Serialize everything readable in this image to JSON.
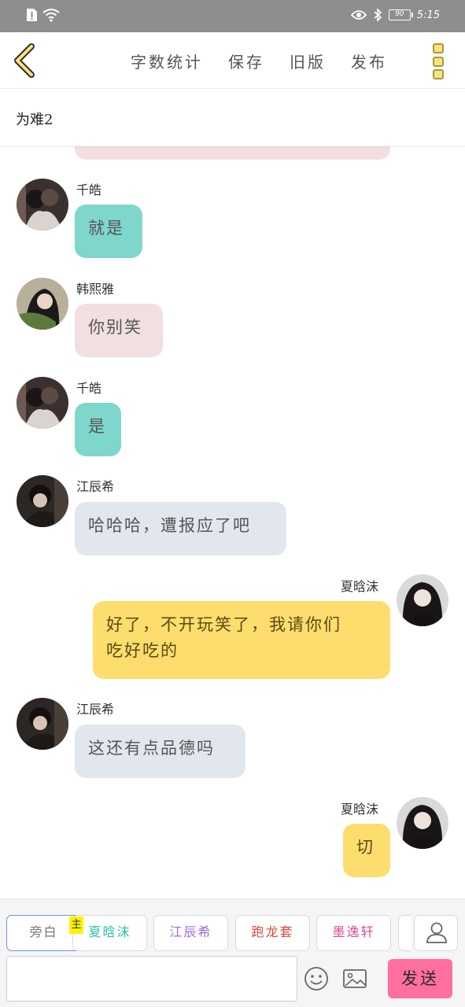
{
  "status": {
    "time": "5:15",
    "battery": "90"
  },
  "nav": {
    "actions": [
      "字数统计",
      "保存",
      "旧版",
      "发布"
    ]
  },
  "title": "为难2",
  "messages": [
    {
      "sender": "千皓",
      "text": "就是"
    },
    {
      "sender": "韩熙雅",
      "text": "你别笑"
    },
    {
      "sender": "千皓",
      "text": "是"
    },
    {
      "sender": "江辰希",
      "text": "哈哈哈，遭报应了吧"
    },
    {
      "sender": "夏晗沫",
      "text_line1": "好了，不开玩笑了，我请你们",
      "text_line2": "吃好吃的"
    },
    {
      "sender": "江辰希",
      "text": "这还有点品德吗"
    },
    {
      "sender": "夏晗沫",
      "text": "切"
    }
  ],
  "composer": {
    "main_tag": "主",
    "roles": [
      {
        "label": "旁白",
        "color": "#555555"
      },
      {
        "label": "夏晗沫",
        "color": "#2bbfae"
      },
      {
        "label": "江辰希",
        "color": "#a66bd6"
      },
      {
        "label": "跑龙套",
        "color": "#e0473a"
      },
      {
        "label": "墨逸轩",
        "color": "#e0479a"
      }
    ],
    "input_placeholder": "",
    "send_label": "发送"
  },
  "colors": {
    "accent_yellow": "#fddd6e",
    "teal_bubble": "#7fd6cb",
    "pink_bubble": "#f2dfe0",
    "gray_bubble": "#e2e7ee",
    "send_button": "#ff6fa0"
  }
}
